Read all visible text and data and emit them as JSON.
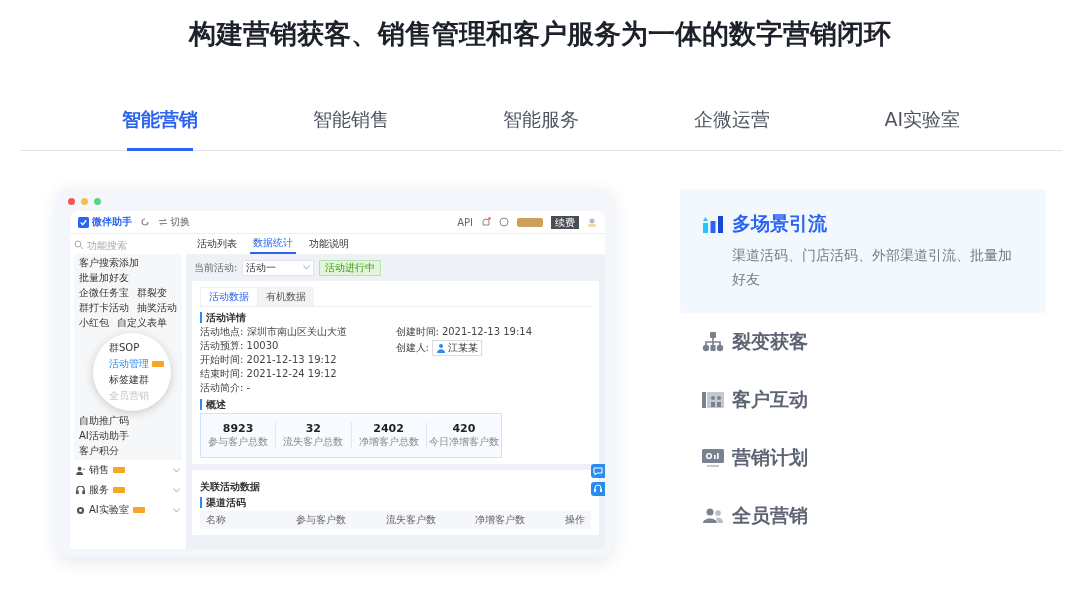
{
  "headline": "构建营销获客、销售管理和客户服务为一体的数字营销闭环",
  "tabs": [
    {
      "label": "智能营销",
      "selected": true
    },
    {
      "label": "智能销售",
      "selected": false
    },
    {
      "label": "智能服务",
      "selected": false
    },
    {
      "label": "企微运营",
      "selected": false
    },
    {
      "label": "AI实验室",
      "selected": false
    }
  ],
  "preview": {
    "logo": "微伴助手",
    "switch": "切换",
    "api": "API",
    "renew": "续费",
    "search_placeholder": "功能搜索",
    "menu_top": [
      [
        "客户搜索添加"
      ],
      [
        "批量加好友"
      ],
      [
        "企微任务宝",
        "群裂变"
      ],
      [
        "群打卡活动",
        "抽奖活动"
      ],
      [
        "小红包",
        "自定义表单"
      ]
    ],
    "magnifier": [
      {
        "label": "群SOP",
        "selected": false,
        "hot": false,
        "dimmed": false
      },
      {
        "label": "活动管理",
        "selected": true,
        "hot": true,
        "dimmed": false
      },
      {
        "label": "标签建群",
        "selected": false,
        "hot": false,
        "dimmed": false
      },
      {
        "label": "全员营销",
        "selected": false,
        "hot": false,
        "dimmed": true
      }
    ],
    "menu_bottom": [
      [
        "自助推广码"
      ],
      [
        "AI活动助手"
      ],
      [
        "客户积分"
      ]
    ],
    "nav": [
      {
        "label": "销售",
        "kind": "sales"
      },
      {
        "label": "服务",
        "kind": "service"
      },
      {
        "label": "AI实验室",
        "kind": "ai"
      }
    ],
    "main_tabs": [
      {
        "label": "活动列表",
        "selected": false
      },
      {
        "label": "数据统计",
        "selected": true
      },
      {
        "label": "功能说明",
        "selected": false
      }
    ],
    "filter_label": "当前活动:",
    "filter_value": "活动一",
    "status": "活动进行中",
    "card_tabs": [
      {
        "label": "活动数据",
        "selected": true
      },
      {
        "label": "有机数据",
        "selected": false
      }
    ],
    "details_title": "活动详情",
    "details": [
      "活动地点: 深圳市南山区关山大道",
      "活动预算: 10030",
      "开始时间: 2021-12-13 19:12",
      "结束时间: 2021-12-24 19:12",
      "活动简介: -"
    ],
    "created_label": "创建时间:",
    "created_value": "2021-12-13 19:14",
    "creator_label": "创建人:",
    "creator": "江某某",
    "overview_title": "概述",
    "stats": [
      {
        "value": "8923",
        "label": "参与客户总数"
      },
      {
        "value": "32",
        "label": "流失客户总数"
      },
      {
        "value": "2402",
        "label": "净增客户总数"
      },
      {
        "value": "420",
        "label": "今日净增客户数"
      }
    ],
    "related_title": "关联活动数据",
    "related_sub": "渠道活码",
    "columns": [
      "名称",
      "参与客户数",
      "流失客户数",
      "净增客户数",
      "操作"
    ]
  },
  "features": [
    {
      "kind": "bars",
      "title": "多场景引流",
      "description": "渠道活码、门店活码、外部渠道引流、批量加好友",
      "selected": true
    },
    {
      "kind": "tree",
      "title": "裂变获客",
      "selected": false
    },
    {
      "kind": "panel",
      "title": "客户互动",
      "selected": false
    },
    {
      "kind": "screen",
      "title": "营销计划",
      "selected": false
    },
    {
      "kind": "people",
      "title": "全员营销",
      "selected": false
    }
  ]
}
